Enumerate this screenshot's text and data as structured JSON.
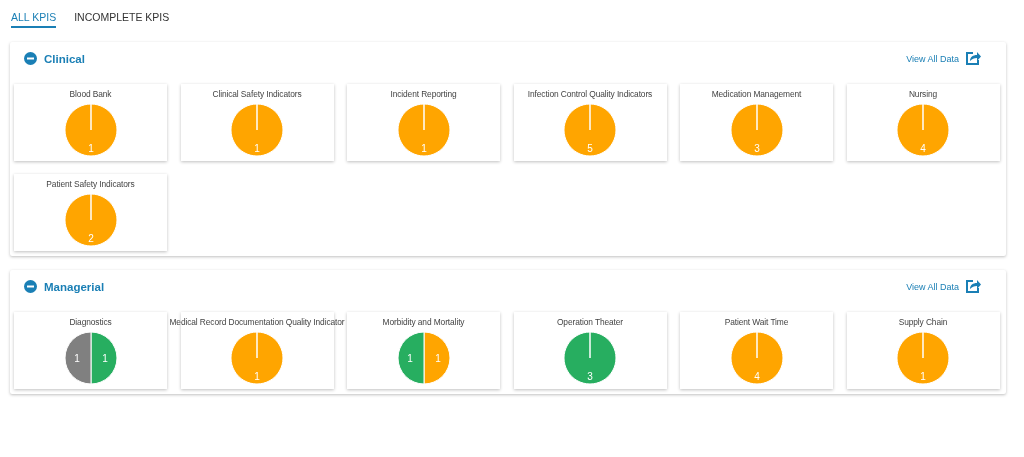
{
  "tabs": [
    {
      "label": "ALL KPIS",
      "selected": true
    },
    {
      "label": "INCOMPLETE KPIS",
      "selected": false
    }
  ],
  "sections": [
    {
      "title": "Clinical",
      "expanded": true,
      "link": "View All Data",
      "cards": [
        {
          "title": "Blood Bank",
          "chart_data": {
            "type": "pie",
            "data_labels": true,
            "series": [
              {
                "color": "#ffa500",
                "values": [
                  1
                ]
              }
            ]
          }
        },
        {
          "title": "Clinical Safety Indicators",
          "chart_data": {
            "type": "pie",
            "data_labels": true,
            "series": [
              {
                "color": "#ffa500",
                "values": [
                  1
                ]
              }
            ]
          }
        },
        {
          "title": "Incident Reporting",
          "chart_data": {
            "type": "pie",
            "data_labels": true,
            "series": [
              {
                "color": "#ffa500",
                "values": [
                  1
                ]
              }
            ]
          }
        },
        {
          "title": "Infection Control Quality Indicators",
          "chart_data": {
            "type": "pie",
            "data_labels": true,
            "series": [
              {
                "color": "#ffa500",
                "values": [
                  5
                ]
              }
            ]
          }
        },
        {
          "title": "Medication Management",
          "chart_data": {
            "type": "pie",
            "data_labels": true,
            "series": [
              {
                "color": "#ffa500",
                "values": [
                  3
                ]
              }
            ]
          }
        },
        {
          "title": "Nursing",
          "chart_data": {
            "type": "pie",
            "data_labels": true,
            "series": [
              {
                "color": "#ffa500",
                "values": [
                  4
                ]
              }
            ]
          }
        },
        {
          "title": "Patient Safety Indicators",
          "chart_data": {
            "type": "pie",
            "data_labels": true,
            "series": [
              {
                "color": "#ffa500",
                "values": [
                  2
                ]
              }
            ]
          }
        }
      ]
    },
    {
      "title": "Managerial",
      "expanded": true,
      "link": "View All Data",
      "cards": [
        {
          "title": "Diagnostics",
          "chart_data": {
            "type": "pie",
            "data_labels": true,
            "values": [
              1,
              1
            ],
            "colors": [
              "#27ae60",
              "#808080"
            ]
          }
        },
        {
          "title": "Medical Record Documentation Quality Indicator",
          "chart_data": {
            "type": "pie",
            "data_labels": true,
            "series": [
              {
                "color": "#ffa500",
                "values": [
                  1
                ]
              }
            ]
          }
        },
        {
          "title": "Morbidity and Mortality",
          "chart_data": {
            "type": "pie",
            "data_labels": true,
            "values": [
              1,
              1
            ],
            "colors": [
              "#ffa500",
              "#27ae60"
            ]
          }
        },
        {
          "title": "Operation Theater",
          "chart_data": {
            "type": "pie",
            "data_labels": true,
            "series": [
              {
                "color": "#27ae60",
                "values": [
                  3
                ]
              }
            ]
          }
        },
        {
          "title": "Patient Wait Time",
          "chart_data": {
            "type": "pie",
            "data_labels": true,
            "series": [
              {
                "color": "#ffa500",
                "values": [
                  4
                ]
              }
            ]
          }
        },
        {
          "title": "Supply Chain",
          "chart_data": {
            "type": "pie",
            "data_labels": true,
            "series": [
              {
                "color": "#ffa500",
                "values": [
                  1
                ]
              }
            ]
          }
        }
      ]
    }
  ]
}
